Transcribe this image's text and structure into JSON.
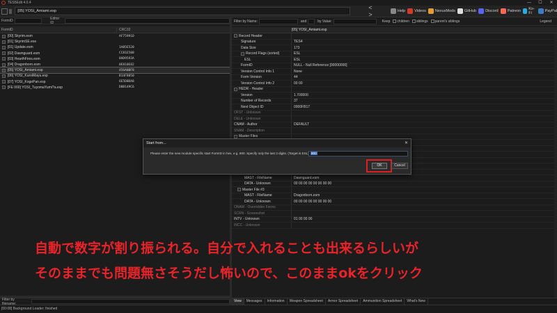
{
  "window": {
    "title": "TES5Edit 4.0.4",
    "controls": [
      "—",
      "☐",
      "✕"
    ]
  },
  "toolbar": {
    "file_path": "[05] YOSI_Amiami.esp",
    "nav": "< >",
    "links": [
      {
        "label": "Help",
        "icon": "help-icon",
        "color": "#888888"
      },
      {
        "label": "Videos",
        "icon": "videos-icon",
        "color": "#d33a2c"
      },
      {
        "label": "NexusMods",
        "icon": "nexusmods-icon",
        "color": "#e39d37"
      },
      {
        "label": "GitHub",
        "icon": "github-icon",
        "color": "#dddddd"
      },
      {
        "label": "Discord",
        "icon": "discord-icon",
        "color": "#5865f2"
      },
      {
        "label": "Patreon",
        "icon": "patreon-icon",
        "color": "#f96854"
      },
      {
        "label": "Ko-Fi",
        "icon": "kofi-icon",
        "color": "#29abe0"
      },
      {
        "label": "PayPal",
        "icon": "paypal-icon",
        "color": "#3b7bbf"
      }
    ]
  },
  "left": {
    "tab_path": "[05] YOSI_Amiami.esp (456A0BF8)",
    "formid_label": "FormID",
    "editorid_label": "Editor ID",
    "col_formid": "FormID",
    "col_crc": "CRC32",
    "rows": [
      {
        "name": "[00] Skyrim.esm",
        "crc": "AF75991D"
      },
      {
        "name": "[01] SkyrimSE.exe",
        "crc": ""
      },
      {
        "name": "[01] Update.esm",
        "crc": "1A85E520"
      },
      {
        "name": "[02] Dawnguard.esm",
        "crc": "CC81E508"
      },
      {
        "name": "[03] HearthFires.esm",
        "crc": "8AD9593A"
      },
      {
        "name": "[04] Dragonborn.esm",
        "crc": "0E810E82"
      },
      {
        "name": "[05] YOSI_Amiami.esp",
        "crc": "456A0BF8",
        "selected": true
      },
      {
        "name": "[06] YOSI_KuroiMayu.esp",
        "crc": "B14F8850"
      },
      {
        "name": "[07] YOSI_KogePan.esp",
        "crc": "6E5D8DA8"
      },
      {
        "name": "[FE 000] YOSI_TuyomaYumi?a.esp",
        "crc": "D8B149C6"
      }
    ],
    "filter_by_filename": "Filter by filename:"
  },
  "right": {
    "filter_by_name": "Filter by Name:",
    "and": "and",
    "by_value": "by Value:",
    "keep": "Keep",
    "children": "children",
    "siblings": "siblings",
    "parents_siblings": "parent's siblings",
    "legend": "Legend",
    "record_file": "[05] YOSI_Amiami.esp",
    "records": [
      {
        "k": "Record Header",
        "v": "",
        "indent": 0,
        "box": "−"
      },
      {
        "k": "Signature",
        "v": "TES4",
        "indent": 2
      },
      {
        "k": "Data Size",
        "v": "173",
        "indent": 2
      },
      {
        "k": "Record Flags (sorted)",
        "v": "ESL",
        "indent": 2,
        "box": "−"
      },
      {
        "k": "ESL",
        "v": "ESL",
        "indent": 3
      },
      {
        "k": "FormID",
        "v": "NULL - Null Reference [00000000]",
        "indent": 2
      },
      {
        "k": "Version Control Info 1",
        "v": "None",
        "indent": 2
      },
      {
        "k": "Form Version",
        "v": "44",
        "indent": 2
      },
      {
        "k": "Version Control Info 2",
        "v": "00 00",
        "indent": 2
      },
      {
        "k": "HEDR - Header",
        "v": "",
        "indent": 0,
        "box": "−"
      },
      {
        "k": "Version",
        "v": "1.700000",
        "indent": 2
      },
      {
        "k": "Number of Records",
        "v": "37",
        "indent": 2
      },
      {
        "k": "Next Object ID",
        "v": "0000FB17",
        "indent": 2
      },
      {
        "k": "OFST - Unknown",
        "v": "",
        "indent": 0,
        "dim": true
      },
      {
        "k": "DELE - Unknown",
        "v": "",
        "indent": 0,
        "dim": true
      },
      {
        "k": "CNAM - Author",
        "v": "DEFAULT",
        "indent": 0
      },
      {
        "k": "SNAM - Description",
        "v": "",
        "indent": 0,
        "dim": true
      },
      {
        "k": "Master Files",
        "v": "",
        "indent": 0,
        "box": "−"
      },
      {
        "k": "",
        "v": "",
        "indent": 0
      },
      {
        "k": "",
        "v": "",
        "indent": 0
      },
      {
        "k": "",
        "v": "",
        "indent": 0
      },
      {
        "k": "",
        "v": "",
        "indent": 0
      },
      {
        "k": "DATA - Unknown",
        "v": "",
        "indent": 3
      },
      {
        "k": "Master File #2",
        "v": "",
        "indent": 1,
        "box": "−"
      },
      {
        "k": "MAST - FileName",
        "v": "Dawnguard.esm",
        "indent": 3
      },
      {
        "k": "DATA - Unknown",
        "v": "00 00 00 00 00 00 00 00",
        "indent": 3
      },
      {
        "k": "Master File #3",
        "v": "",
        "indent": 1,
        "box": "−"
      },
      {
        "k": "MAST - FileName",
        "v": "Dragonborn.esm",
        "indent": 3
      },
      {
        "k": "DATA - Unknown",
        "v": "00 00 00 00 00 00 00 00",
        "indent": 3
      },
      {
        "k": "ONAM - Overridden Forms",
        "v": "",
        "indent": 0,
        "dim": true
      },
      {
        "k": "SCRN - Screenshot",
        "v": "",
        "indent": 0,
        "dim": true
      },
      {
        "k": "INTV - Unknown",
        "v": "01 00 00 00",
        "indent": 0
      },
      {
        "k": "INCC - Unknown",
        "v": "",
        "indent": 0,
        "dim": true
      }
    ],
    "tabs": [
      {
        "label": "View",
        "active": true
      },
      {
        "label": "Messages"
      },
      {
        "label": "Information"
      },
      {
        "label": "Weapon Spreadsheet"
      },
      {
        "label": "Armor Spreadsheet"
      },
      {
        "label": "Ammunition Spreadsheet"
      },
      {
        "label": "What's New"
      }
    ]
  },
  "status": "[00:08] Background Loader: finished",
  "dialog": {
    "title": "Start from...",
    "message": "Please enter the new module specific start FormID in hex. e.g. 800. Specify only the last 3 digits. (Target is ESL)",
    "input_value": "800",
    "ok": "OK",
    "cancel": "Cancel",
    "highlight_color": "#e02020"
  },
  "caption": {
    "line1": "自動で数字が割り振られる。自分で入れることも出来るらしいが",
    "line2": "そのままでも問題無さそうだし怖いので、このままokをクリック",
    "color": "#e8242a"
  }
}
